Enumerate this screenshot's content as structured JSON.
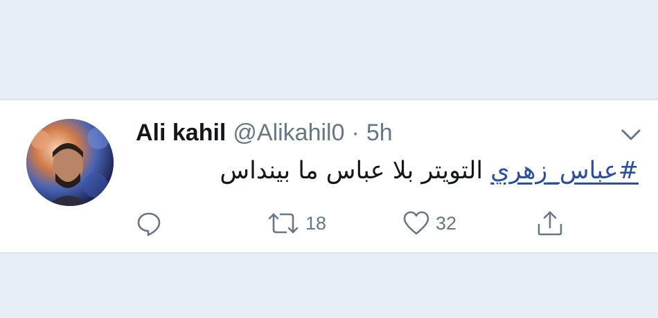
{
  "tweet": {
    "user_name": "Ali kahil",
    "handle": "@Alikahil0",
    "separator": "·",
    "time": "5h",
    "hashtag": "#عباس_زهري",
    "body": "التويتر بلا عباس ما بينداس",
    "stats": {
      "retweets": "18",
      "likes": "32"
    }
  },
  "icons": {
    "menu": "chevron-down-icon",
    "reply": "reply-icon",
    "retweet": "retweet-icon",
    "like": "heart-icon",
    "share": "share-icon"
  },
  "colors": {
    "text": "#14171a",
    "secondary": "#657786",
    "hashtag": "#2b4f9c",
    "background": "#e8eef7"
  }
}
